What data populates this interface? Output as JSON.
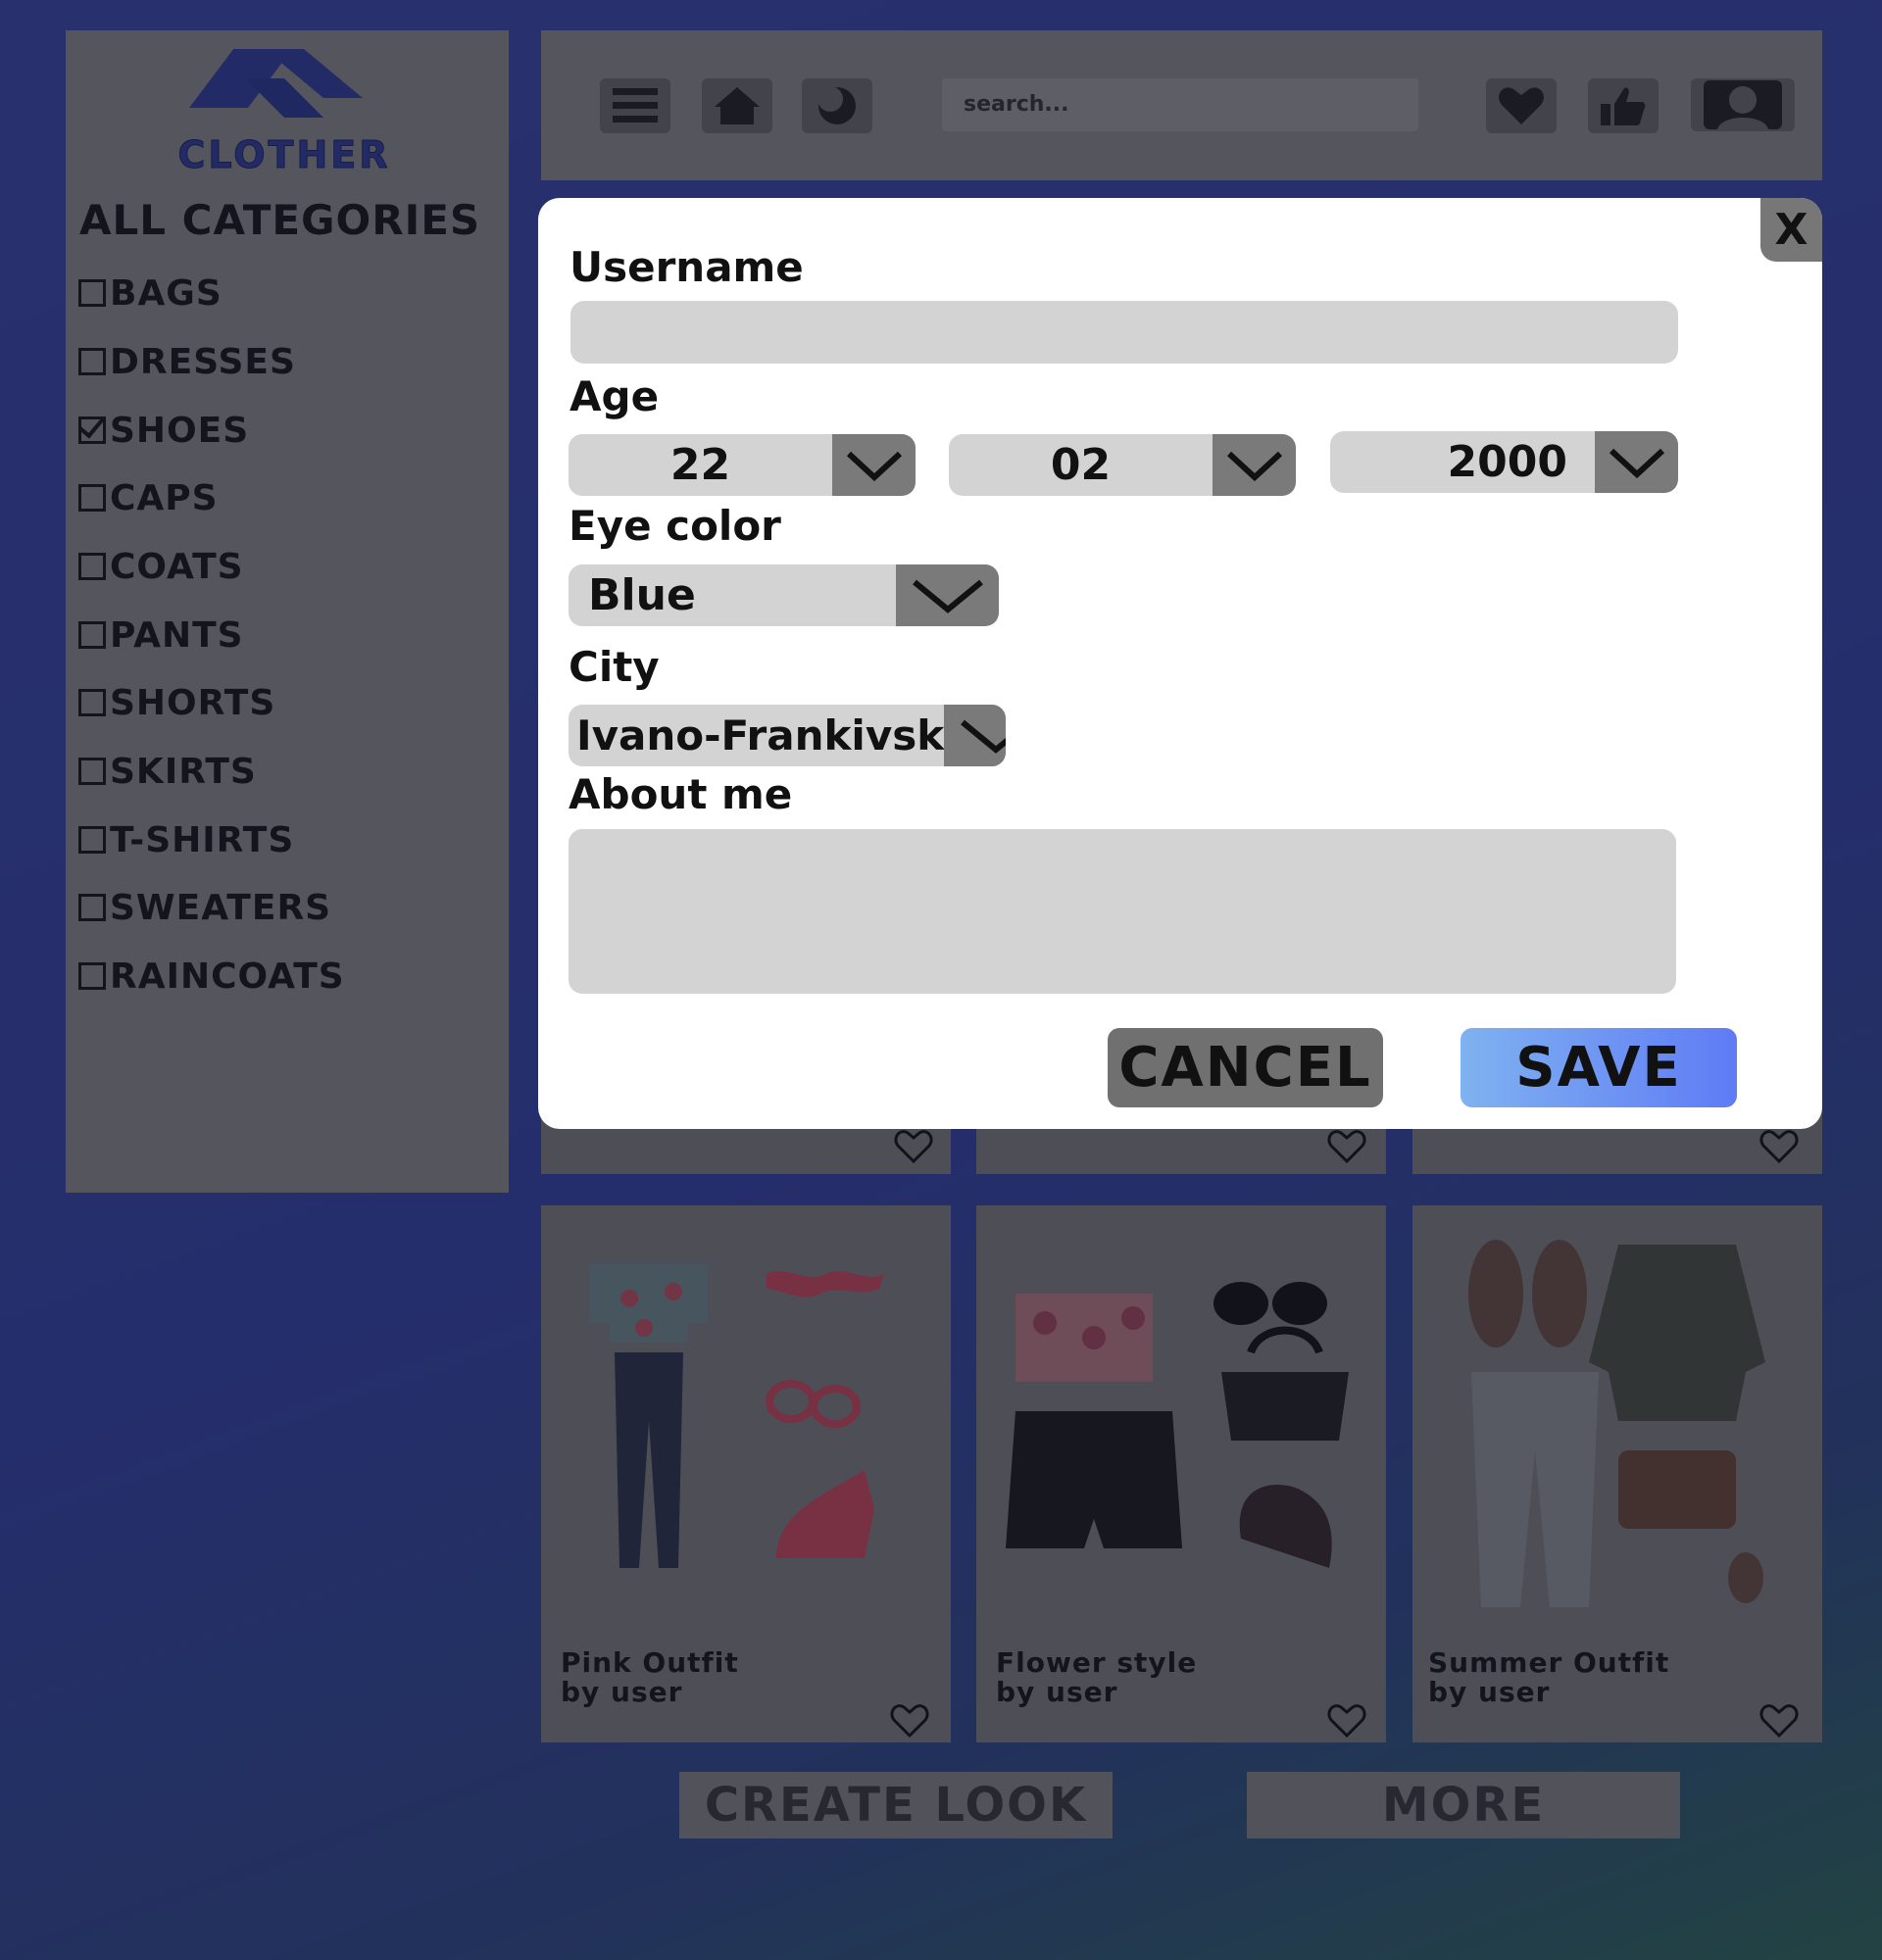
{
  "app": {
    "logo_text": "CLOTHER"
  },
  "sidebar": {
    "title": "ALL CATEGORIES",
    "items": [
      {
        "label": "BAGS",
        "checked": false
      },
      {
        "label": "DRESSES",
        "checked": false
      },
      {
        "label": "SHOES",
        "checked": true
      },
      {
        "label": "CAPS",
        "checked": false
      },
      {
        "label": "COATS",
        "checked": false
      },
      {
        "label": "PANTS",
        "checked": false
      },
      {
        "label": "SHORTS",
        "checked": false
      },
      {
        "label": "SKIRTS",
        "checked": false
      },
      {
        "label": "T-SHIRTS",
        "checked": false
      },
      {
        "label": "SWEATERS",
        "checked": false
      },
      {
        "label": "RAINCOATS",
        "checked": false
      }
    ]
  },
  "topbar": {
    "search_placeholder": "search...",
    "icons": [
      "menu-icon",
      "home-icon",
      "moon-icon",
      "heart-icon",
      "thumbs-up-icon",
      "profile-icon"
    ]
  },
  "cards": [
    {
      "title": "Pink Outfit",
      "author": "by user"
    },
    {
      "title": "Flower style",
      "author": "by user"
    },
    {
      "title": "Summer Outfit",
      "author": "by user"
    }
  ],
  "bottom_buttons": {
    "create_look": "CREATE LOOK",
    "more": "MORE"
  },
  "modal": {
    "close_label": "X",
    "username_label": "Username",
    "username_value": "",
    "age_label": "Age",
    "age_day": "22",
    "age_month": "02",
    "age_year": "2000",
    "eye_color_label": "Eye color",
    "eye_color_value": "Blue",
    "city_label": "City",
    "city_value": "Ivano-Frankivsk",
    "about_label": "About me",
    "about_value": "",
    "cancel_label": "CANCEL",
    "save_label": "SAVE"
  },
  "colors": {
    "save_gradient_start": "#7fb2f0",
    "save_gradient_end": "#5f7bf5",
    "logo": "#2f3f9a"
  }
}
